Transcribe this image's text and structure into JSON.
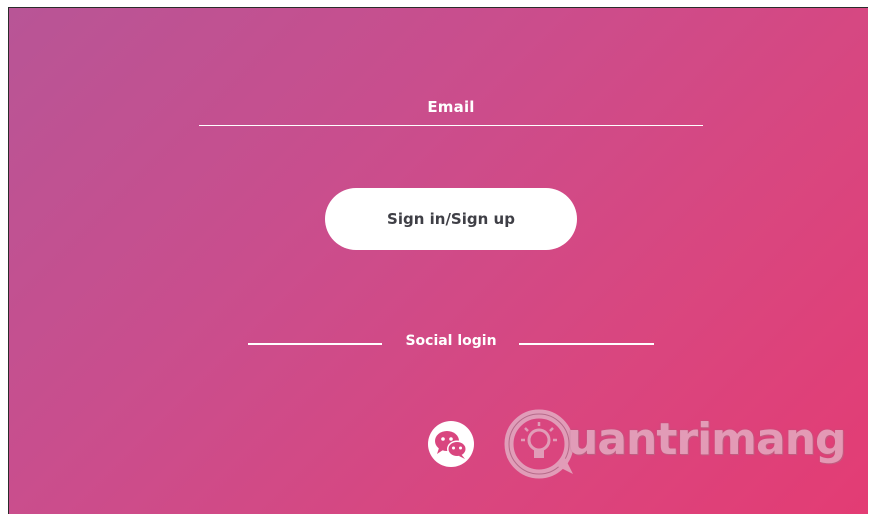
{
  "form": {
    "email_label": "Email",
    "signin_label": "Sign in/Sign up"
  },
  "social": {
    "divider_label": "Social login",
    "providers": [
      "wechat-icon"
    ]
  },
  "watermark": {
    "text": "uantrimang",
    "logo": "Quantrimang"
  },
  "colors": {
    "gradient_start": "#b85596",
    "gradient_end": "#e33c74",
    "button_bg": "#ffffff",
    "button_text": "#3f3f46"
  }
}
